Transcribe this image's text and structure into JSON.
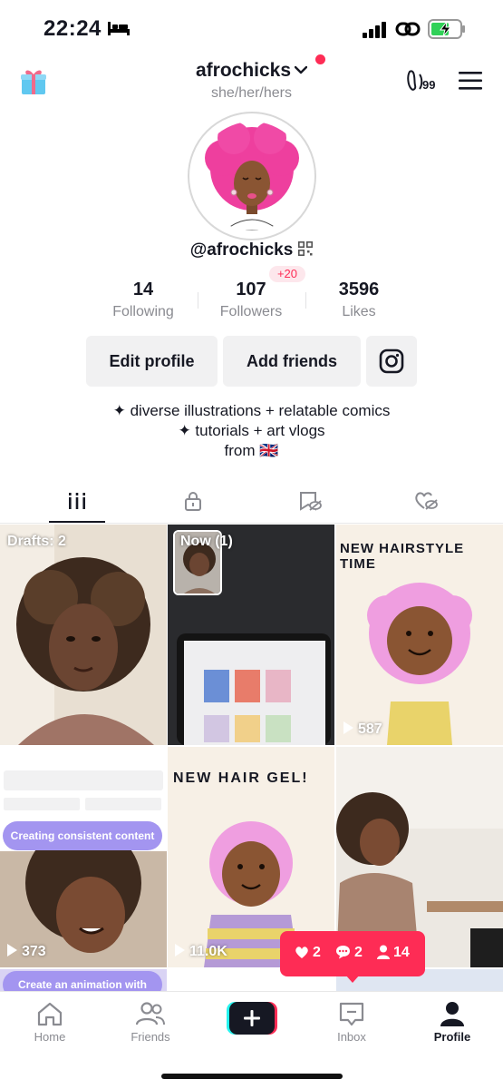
{
  "status_bar": {
    "time": "22:24"
  },
  "header": {
    "username": "afrochicks",
    "pronouns": "she/her/hers",
    "footprint_count": "99"
  },
  "profile": {
    "handle": "@afrochicks",
    "stats": [
      {
        "value": "14",
        "label": "Following"
      },
      {
        "value": "107",
        "label": "Followers",
        "badge": "+20"
      },
      {
        "value": "3596",
        "label": "Likes"
      }
    ],
    "buttons": {
      "edit": "Edit profile",
      "add_friends": "Add friends"
    },
    "bio": [
      "✦ diverse illustrations + relatable comics",
      "✦ tutorials + art vlogs",
      "from 🇬🇧"
    ]
  },
  "tabs": [
    "videos",
    "private",
    "reposts",
    "liked"
  ],
  "grid": [
    {
      "label": "Drafts: 2",
      "views": ""
    },
    {
      "label": "Now (1)",
      "views": ""
    },
    {
      "label": "NEW HAIRSTYLE TIME",
      "views": "587"
    },
    {
      "label": "Creating consistent content",
      "views": "373"
    },
    {
      "label": "NEW HAIR GEL!",
      "views": "11.0K"
    },
    {
      "label": "",
      "views": ""
    }
  ],
  "grid_row3": {
    "caption": "Create an animation with"
  },
  "notification": {
    "likes": "2",
    "comments": "2",
    "followers": "14"
  },
  "nav": [
    {
      "label": "Home"
    },
    {
      "label": "Friends"
    },
    {
      "label": "Inbox"
    },
    {
      "label": "Profile"
    }
  ]
}
